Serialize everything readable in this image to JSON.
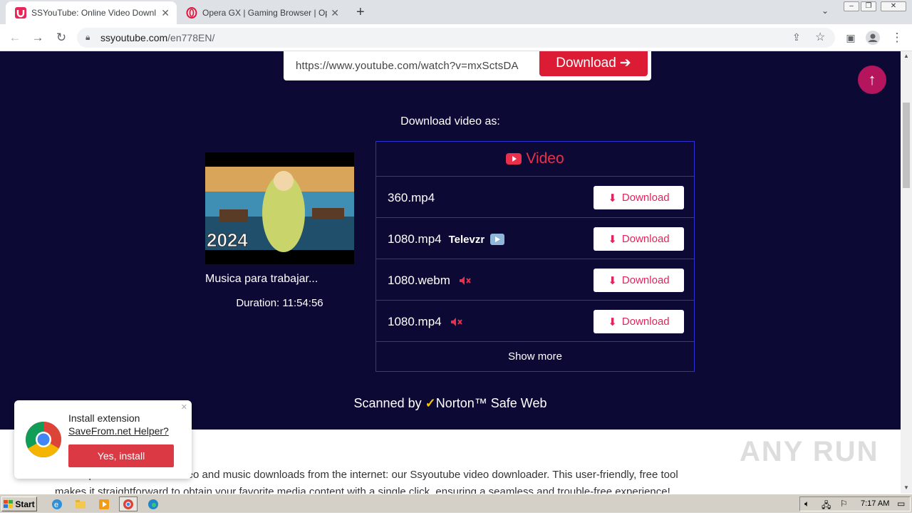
{
  "tabs": [
    {
      "title": "SSYouTube: Online Video Downloade",
      "active": true
    },
    {
      "title": "Opera GX | Gaming Browser | Opera",
      "active": false
    }
  ],
  "toolbar": {
    "url_host": "ssyoutube.com",
    "url_path": "/en778EN/"
  },
  "search": {
    "value": "https://www.youtube.com/watch?v=mxSctsDA",
    "button_label": "Download"
  },
  "download_section": {
    "heading": "Download video as:",
    "video_title": "Musica para trabajar...",
    "duration": "Duration: 11:54:56",
    "thumb_text": "2024",
    "table_header": "Video",
    "rows": [
      {
        "format": "360.mp4",
        "extra": "",
        "muted": false,
        "button": "Download"
      },
      {
        "format": "1080.mp4",
        "extra": "Televzr",
        "muted": false,
        "button": "Download"
      },
      {
        "format": "1080.webm",
        "extra": "",
        "muted": true,
        "button": "Download"
      },
      {
        "format": "1080.mp4",
        "extra": "",
        "muted": true,
        "button": "Download"
      }
    ],
    "show_more": "Show more"
  },
  "scanned": {
    "prefix": "Scanned by",
    "brand": "Norton™ Safe Web"
  },
  "lower_text": {
    "line1": "on for quick and efficient video and music downloads from the internet: our Ssyoutube video downloader. This user-friendly, free tool",
    "line2": "makes it straightforward to obtain your favorite media content with a single click, ensuring a seamless and trouble-free experience!"
  },
  "popup": {
    "line1": "Install extension",
    "line2": "SaveFrom.net Helper?",
    "button": "Yes, install"
  },
  "watermark": "ANY RUN",
  "taskbar": {
    "start": "Start",
    "clock": "7:17 AM"
  },
  "colors": {
    "page_bg": "#0c0a35",
    "accent_red": "#dc1b34",
    "pink": "#e2245c",
    "table_border": "#2f2fd0"
  }
}
